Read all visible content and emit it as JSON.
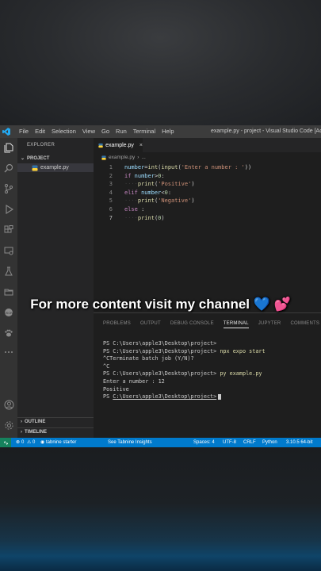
{
  "window": {
    "title": "example.py - project - Visual Studio Code [Adm",
    "menu": [
      "File",
      "Edit",
      "Selection",
      "View",
      "Go",
      "Run",
      "Terminal",
      "Help"
    ]
  },
  "activity_icons": [
    "files-icon",
    "search-icon",
    "source-control-icon",
    "run-debug-icon",
    "extensions-icon",
    "remote-explorer-icon",
    "testing-icon",
    "folder-icon",
    "docker-icon",
    "paw-icon",
    "more-icon",
    "account-icon",
    "settings-gear-icon"
  ],
  "sidebar": {
    "header": "EXPLORER",
    "project": "PROJECT",
    "file": "example.py",
    "outline": "OUTLINE",
    "timeline": "TIMELINE"
  },
  "editor": {
    "tab": "example.py",
    "breadcrumb_file": "example.py",
    "breadcrumb_more": "...",
    "lines": [
      {
        "n": "1",
        "segments": [
          [
            "var",
            "number"
          ],
          [
            "op",
            "="
          ],
          [
            "fn",
            "int"
          ],
          [
            "op",
            "("
          ],
          [
            "fn",
            "input"
          ],
          [
            "op",
            "("
          ],
          [
            "str",
            "'Enter a number : '"
          ],
          [
            "op",
            "))"
          ]
        ]
      },
      {
        "n": "2",
        "segments": [
          [
            "kw",
            "if"
          ],
          [
            "op",
            " "
          ],
          [
            "var",
            "number"
          ],
          [
            "op",
            ">"
          ],
          [
            "num",
            "0"
          ],
          [
            "op",
            ":"
          ]
        ]
      },
      {
        "n": "3",
        "segments": [
          [
            "guide",
            "····"
          ],
          [
            "fn",
            "print"
          ],
          [
            "op",
            "("
          ],
          [
            "str",
            "'Positive'"
          ],
          [
            "op",
            ")"
          ]
        ]
      },
      {
        "n": "4",
        "segments": [
          [
            "kw",
            "elif"
          ],
          [
            "op",
            " "
          ],
          [
            "var",
            "number"
          ],
          [
            "op",
            "<"
          ],
          [
            "num",
            "0"
          ],
          [
            "op",
            ":"
          ]
        ]
      },
      {
        "n": "5",
        "segments": [
          [
            "guide",
            "····"
          ],
          [
            "fn",
            "print"
          ],
          [
            "op",
            "("
          ],
          [
            "str",
            "'Negative'"
          ],
          [
            "op",
            ")"
          ]
        ]
      },
      {
        "n": "6",
        "segments": [
          [
            "kw",
            "else"
          ],
          [
            "op",
            " :"
          ]
        ]
      },
      {
        "n": "7",
        "segments": [
          [
            "guide",
            "····"
          ],
          [
            "fn",
            "print"
          ],
          [
            "op",
            "("
          ],
          [
            "num",
            "0"
          ],
          [
            "op",
            ")"
          ]
        ]
      }
    ]
  },
  "panel": {
    "tabs": [
      "PROBLEMS",
      "OUTPUT",
      "DEBUG CONSOLE",
      "TERMINAL",
      "JUPYTER",
      "COMMENTS"
    ],
    "active_tab": "TERMINAL",
    "terminal": {
      "prompt": "PS C:\\Users\\apple3\\Desktop\\project>",
      "cmd1": "npx expo start",
      "line3": "^CTerminate batch job (Y/N)?",
      "line4": "^C",
      "cmd2": "py example.py",
      "line6": "Enter a number : 12",
      "line7": "Positive",
      "prompt_last": "C:\\Users\\apple3\\Desktop\\project>",
      "ps": "PS "
    }
  },
  "statusbar": {
    "errors": "0",
    "warnings": "0",
    "tabnine": "tabnine starter",
    "insights": "See Tabnine Insights",
    "spaces": "Spaces: 4",
    "encoding": "UTF-8",
    "eol": "CRLF",
    "language": "Python",
    "interpreter": "3.10.5 64-bit"
  },
  "overlay": {
    "caption": "For more content visit my channel 💙 💕"
  }
}
